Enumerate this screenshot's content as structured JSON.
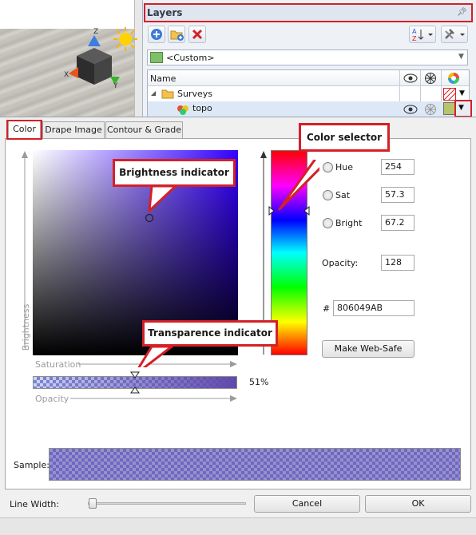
{
  "layers_panel": {
    "title": "Layers",
    "combo_value": "<Custom>",
    "column_name": "Name",
    "rows": [
      {
        "label": "Surveys"
      },
      {
        "label": "topo"
      }
    ]
  },
  "dialog": {
    "tabs": [
      "Color",
      "Drape Image",
      "Contour & Grade"
    ],
    "hsb": {
      "hue_label": "Hue",
      "hue_value": "254",
      "sat_label": "Sat",
      "sat_value": "57.3",
      "bright_label": "Bright",
      "bright_value": "67.2"
    },
    "opacity_label": "Opacity:",
    "opacity_value": "128",
    "hex_label": "#",
    "hex_value": "806049AB",
    "websafe_button": "Make Web-Safe",
    "axis_brightness": "Brightness",
    "axis_saturation": "Saturation",
    "axis_opacity": "Opacity",
    "opacity_percent": "51%",
    "sample_label": "Sample:",
    "line_width_label": "Line Width:",
    "cancel_button": "Cancel",
    "ok_button": "OK"
  },
  "callouts": {
    "brightness": "Brightness indicator",
    "color_selector": "Color selector",
    "transparence": "Transparence indicator"
  },
  "colors": {
    "highlight_red": "#d42027",
    "selected_color": "#6049AB"
  }
}
